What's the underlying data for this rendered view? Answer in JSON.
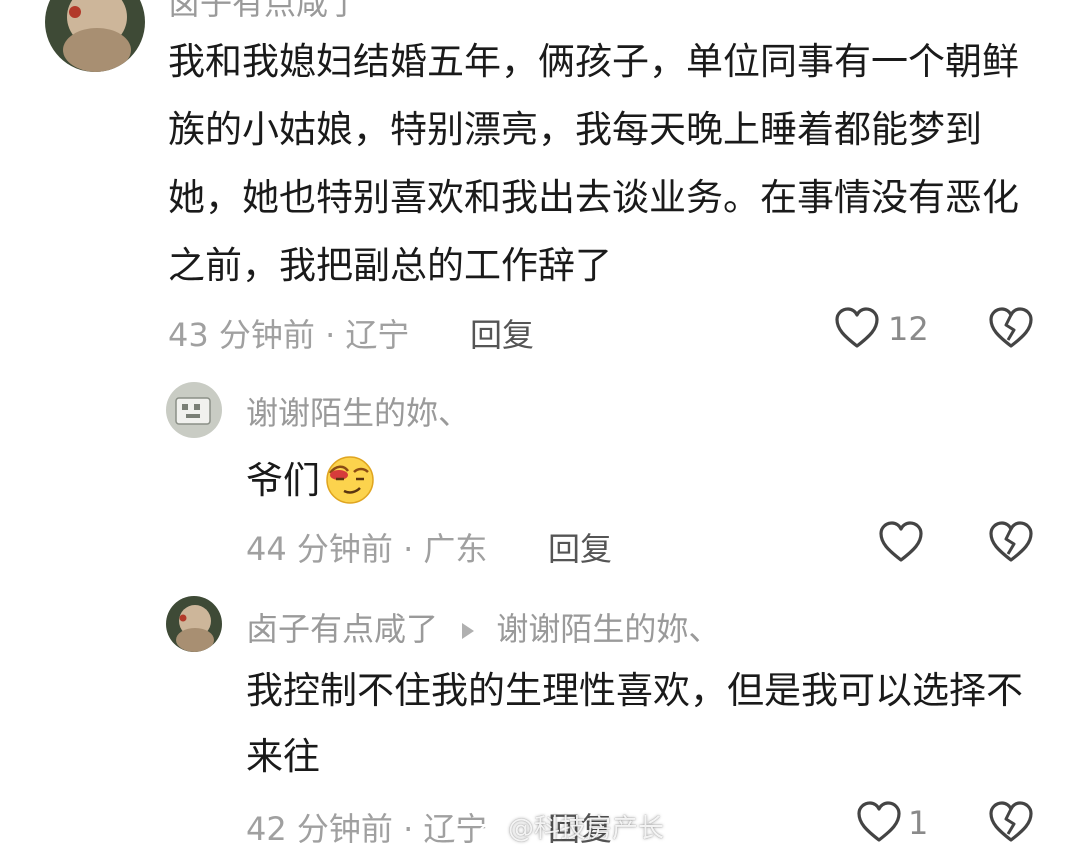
{
  "comments": [
    {
      "username": "卤子有点咸了",
      "content": "我和我媳妇结婚五年，俩孩子，单位同事有一个朝鲜族的小姑娘，特别漂亮，我每天晚上睡着都能梦到她，她也特别喜欢和我出去谈业务。在事情没有恶化之前，我把副总的工作辞了",
      "time": "43 分钟前",
      "location": "辽宁",
      "reply_label": "回复",
      "likes": "12"
    },
    {
      "username": "谢谢陌生的妳、",
      "content": "爷们",
      "emoji": "smirk-face-emoji",
      "time": "44 分钟前",
      "location": "广东",
      "reply_label": "回复",
      "likes": ""
    },
    {
      "username": "卤子有点咸了",
      "reply_to": "谢谢陌生的妳、",
      "content": "我控制不住我的生理性喜欢，但是我可以选择不来往",
      "time": "42 分钟前",
      "location": "辽宁",
      "reply_label": "回复",
      "likes": "1"
    }
  ],
  "separator": "·",
  "watermark": "@科技房产长",
  "icons": {
    "like": "heart-outline-icon",
    "dislike": "broken-heart-icon",
    "reply_arrow": "triangle-right-icon"
  }
}
